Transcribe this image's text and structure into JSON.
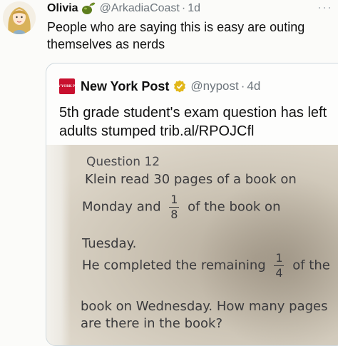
{
  "tweet": {
    "display_name": "Olivia",
    "handle": "@ArkadiaCoast",
    "separator": "·",
    "time": "1d",
    "more": "···",
    "text": "People who are saying this is easy are outing themselves as nerds"
  },
  "quote": {
    "logo_text": "NEW YORK POST",
    "display_name": "New York Post",
    "handle": "@nypost",
    "separator": "·",
    "time": "4d",
    "text": "5th grade student's exam question has left adults stumped trib.al/RPOJCfl"
  },
  "exam": {
    "question_title": "Question 12",
    "line1": "Klein read 30 pages of a book on",
    "line2_before": "Monday and",
    "fraction1_num": "1",
    "fraction1_den": "8",
    "line2_after": "of the book on",
    "line3": "Tuesday.",
    "line4_before": "He completed the remaining",
    "fraction2_num": "1",
    "fraction2_den": "4",
    "line4_after": "of the",
    "line5": "book on Wednesday. How many pages",
    "line6": "are there in the book?"
  },
  "icons": {
    "avatar": "avatar-illustration",
    "olive": "olive-emoji-icon",
    "verified": "gold-verified-badge-icon",
    "more": "more-options-icon"
  },
  "colors": {
    "nyp_red": "#c8102e",
    "verified_gold": "#e2b719",
    "muted_text": "#6e767d"
  }
}
